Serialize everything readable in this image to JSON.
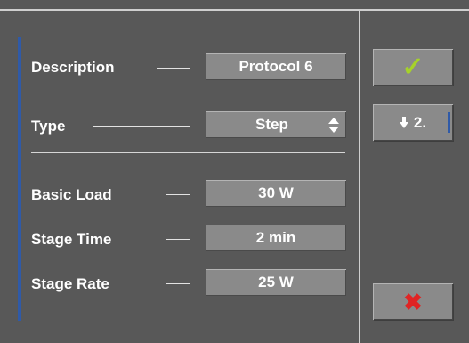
{
  "form": {
    "description": {
      "label": "Description",
      "value": "Protocol 6"
    },
    "type": {
      "label": "Type",
      "value": "Step"
    },
    "basic_load": {
      "label": "Basic Load",
      "value": "30 W"
    },
    "stage_time": {
      "label": "Stage Time",
      "value": "2 min"
    },
    "stage_rate": {
      "label": "Stage Rate",
      "value": "25 W"
    }
  },
  "side_buttons": {
    "confirm_icon": "checkmark-icon",
    "next_label": "2.",
    "next_icon": "arrow-down-icon",
    "cancel_icon": "x-mark-icon"
  },
  "colors": {
    "background": "#585858",
    "field": "#8a8a8a",
    "accent": "#2f5aa8",
    "confirm": "#a6d22a",
    "cancel": "#e02424"
  }
}
